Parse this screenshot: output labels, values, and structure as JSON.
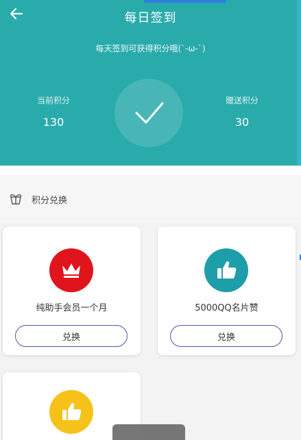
{
  "header": {
    "title": "每日签到",
    "subtitle": "每天签到可获得积分哦(`-ω-`)",
    "back_icon": "arrow-left-icon",
    "checkin_icon": "check-icon",
    "bg_color": "#2aabab"
  },
  "points": {
    "current_label": "当前积分",
    "current_value": "130",
    "bonus_label": "赠送积分",
    "bonus_value": "30"
  },
  "exchange": {
    "section_label": "积分兑换",
    "section_icon": "gift-icon",
    "button_color": "#4a56a6",
    "items": [
      {
        "title": "纯助手会员一个月",
        "button": "兑换",
        "icon": "crown-icon",
        "icon_color": "#e0141c"
      },
      {
        "title": "5000QQ名片赞",
        "button": "兑换",
        "icon": "thumbs-up-icon",
        "icon_color": "#1e9ea8"
      },
      {
        "title": "",
        "button": "",
        "icon": "thumbs-up-icon",
        "icon_color": "#f6c21a"
      }
    ]
  }
}
